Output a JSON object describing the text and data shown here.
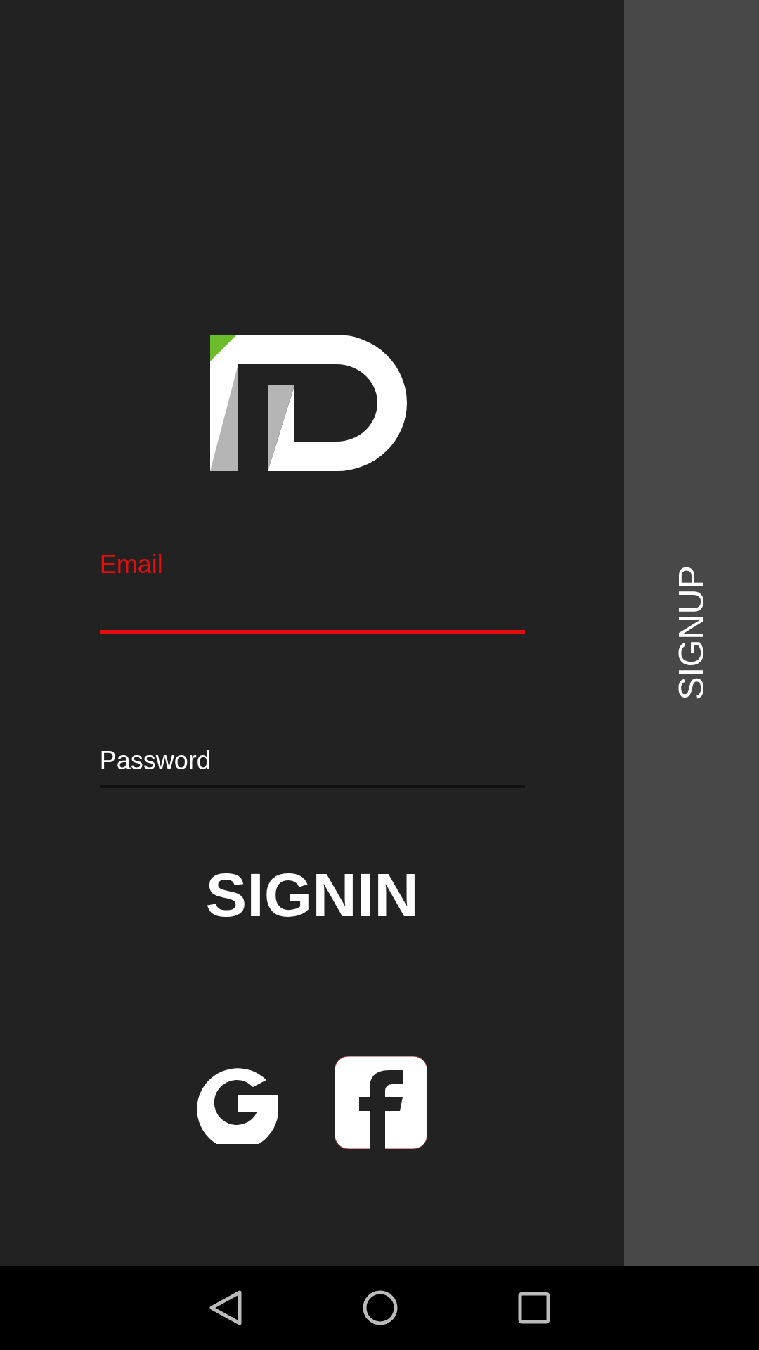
{
  "fields": [
    {
      "label": "Email",
      "focused": true
    },
    {
      "label": "Password",
      "focused": false
    }
  ],
  "signin_button": "SIGNIN",
  "signup_tab": "SIGNUP"
}
